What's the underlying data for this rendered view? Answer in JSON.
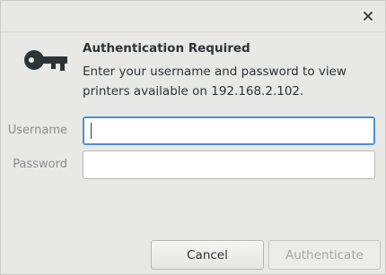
{
  "dialog": {
    "close_glyph": "✕",
    "heading": "Authentication Required",
    "message": "Enter your username and password to view printers available on 192.168.2.102.",
    "icon": "key-icon"
  },
  "form": {
    "username_label": "Username",
    "username_value": "",
    "password_label": "Password",
    "password_value": ""
  },
  "buttons": {
    "cancel_label": "Cancel",
    "authenticate_label": "Authenticate"
  },
  "colors": {
    "focus_border": "#4a90d9",
    "background": "#e8e8e7"
  }
}
